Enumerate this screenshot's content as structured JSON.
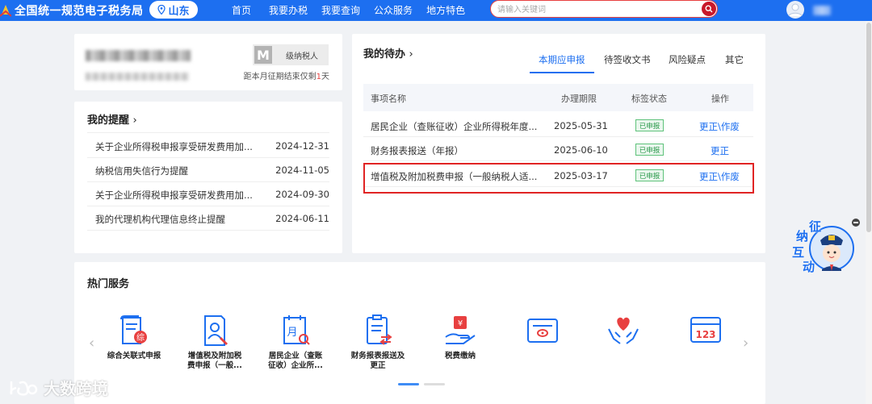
{
  "header": {
    "site_title": "全国统一规范电子税务局",
    "region": "山东",
    "nav": [
      "首页",
      "我要办税",
      "我要查询",
      "公众服务",
      "地方特色"
    ],
    "search_placeholder": "请输入关键词"
  },
  "profile": {
    "badge_letter": "M",
    "badge_text": "级纳税人",
    "deadline_prefix": "距本月征期结束仅剩",
    "deadline_days": "1",
    "deadline_suffix": "天"
  },
  "reminders": {
    "title": "我的提醒",
    "items": [
      {
        "title": "关于企业所得税申报享受研发费用加...",
        "date": "2024-12-31"
      },
      {
        "title": "纳税信用失信行为提醒",
        "date": "2024-11-05"
      },
      {
        "title": "关于企业所得税申报享受研发费用加...",
        "date": "2024-09-30"
      },
      {
        "title": "我的代理机构代理信息终止提醒",
        "date": "2024-06-11"
      }
    ]
  },
  "todo": {
    "title": "我的待办",
    "tabs": [
      "本期应申报",
      "待签收文书",
      "风险疑点",
      "其它"
    ],
    "active_tab": "本期应申报",
    "columns": [
      "事项名称",
      "办理期限",
      "标签状态",
      "操作"
    ],
    "rows": [
      {
        "name": "居民企业（查账征收）企业所得税年度...",
        "deadline": "2025-05-31",
        "status": "已申报",
        "action": "更正\\作废"
      },
      {
        "name": "财务报表报送（年报）",
        "deadline": "2025-06-10",
        "status": "已申报",
        "action": "更正"
      },
      {
        "name": "增值税及附加税费申报（一般纳税人适...",
        "deadline": "2025-03-17",
        "status": "已申报",
        "action": "更正\\作废"
      }
    ]
  },
  "hot_services": {
    "title": "热门服务",
    "items": [
      {
        "line1": "综合关联式申报",
        "line2": "",
        "icon": "comprehensive-declaration-icon"
      },
      {
        "line1": "增值税及附加税",
        "line2": "费申报（一般...",
        "icon": "vat-declaration-icon"
      },
      {
        "line1": "居民企业（查账",
        "line2": "征收）企业所...",
        "icon": "corporate-income-tax-icon"
      },
      {
        "line1": "财务报表报送及",
        "line2": "更正",
        "icon": "financial-report-icon"
      },
      {
        "line1": "税费缴纳",
        "line2": "",
        "icon": "tax-payment-icon"
      },
      {
        "line1": "",
        "line2": "",
        "icon": "id-card-icon"
      },
      {
        "line1": "",
        "line2": "",
        "icon": "care-service-icon"
      },
      {
        "line1": "",
        "line2": "",
        "icon": "number-123-icon"
      }
    ]
  },
  "assistant": {
    "chars": [
      "征",
      "纳",
      "互",
      "动"
    ]
  },
  "watermark": "大数跨境",
  "colors": {
    "brand_blue": "#1d6ff0",
    "highlight_red": "#e02424",
    "status_green": "#2c9a4c",
    "search_red": "#c8182a"
  }
}
